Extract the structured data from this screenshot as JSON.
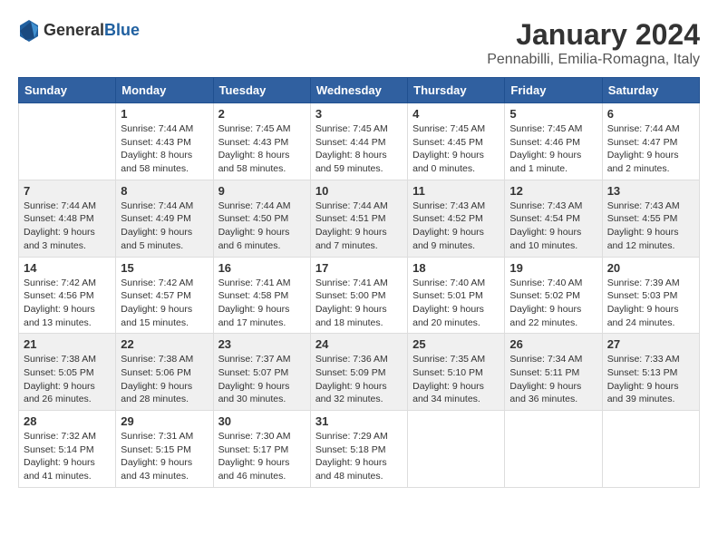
{
  "logo": {
    "general": "General",
    "blue": "Blue"
  },
  "title": "January 2024",
  "location": "Pennabilli, Emilia-Romagna, Italy",
  "weekdays": [
    "Sunday",
    "Monday",
    "Tuesday",
    "Wednesday",
    "Thursday",
    "Friday",
    "Saturday"
  ],
  "weeks": [
    [
      {
        "day": "",
        "info": ""
      },
      {
        "day": "1",
        "info": "Sunrise: 7:44 AM\nSunset: 4:43 PM\nDaylight: 8 hours\nand 58 minutes."
      },
      {
        "day": "2",
        "info": "Sunrise: 7:45 AM\nSunset: 4:43 PM\nDaylight: 8 hours\nand 58 minutes."
      },
      {
        "day": "3",
        "info": "Sunrise: 7:45 AM\nSunset: 4:44 PM\nDaylight: 8 hours\nand 59 minutes."
      },
      {
        "day": "4",
        "info": "Sunrise: 7:45 AM\nSunset: 4:45 PM\nDaylight: 9 hours\nand 0 minutes."
      },
      {
        "day": "5",
        "info": "Sunrise: 7:45 AM\nSunset: 4:46 PM\nDaylight: 9 hours\nand 1 minute."
      },
      {
        "day": "6",
        "info": "Sunrise: 7:44 AM\nSunset: 4:47 PM\nDaylight: 9 hours\nand 2 minutes."
      }
    ],
    [
      {
        "day": "7",
        "info": "Sunrise: 7:44 AM\nSunset: 4:48 PM\nDaylight: 9 hours\nand 3 minutes."
      },
      {
        "day": "8",
        "info": "Sunrise: 7:44 AM\nSunset: 4:49 PM\nDaylight: 9 hours\nand 5 minutes."
      },
      {
        "day": "9",
        "info": "Sunrise: 7:44 AM\nSunset: 4:50 PM\nDaylight: 9 hours\nand 6 minutes."
      },
      {
        "day": "10",
        "info": "Sunrise: 7:44 AM\nSunset: 4:51 PM\nDaylight: 9 hours\nand 7 minutes."
      },
      {
        "day": "11",
        "info": "Sunrise: 7:43 AM\nSunset: 4:52 PM\nDaylight: 9 hours\nand 9 minutes."
      },
      {
        "day": "12",
        "info": "Sunrise: 7:43 AM\nSunset: 4:54 PM\nDaylight: 9 hours\nand 10 minutes."
      },
      {
        "day": "13",
        "info": "Sunrise: 7:43 AM\nSunset: 4:55 PM\nDaylight: 9 hours\nand 12 minutes."
      }
    ],
    [
      {
        "day": "14",
        "info": "Sunrise: 7:42 AM\nSunset: 4:56 PM\nDaylight: 9 hours\nand 13 minutes."
      },
      {
        "day": "15",
        "info": "Sunrise: 7:42 AM\nSunset: 4:57 PM\nDaylight: 9 hours\nand 15 minutes."
      },
      {
        "day": "16",
        "info": "Sunrise: 7:41 AM\nSunset: 4:58 PM\nDaylight: 9 hours\nand 17 minutes."
      },
      {
        "day": "17",
        "info": "Sunrise: 7:41 AM\nSunset: 5:00 PM\nDaylight: 9 hours\nand 18 minutes."
      },
      {
        "day": "18",
        "info": "Sunrise: 7:40 AM\nSunset: 5:01 PM\nDaylight: 9 hours\nand 20 minutes."
      },
      {
        "day": "19",
        "info": "Sunrise: 7:40 AM\nSunset: 5:02 PM\nDaylight: 9 hours\nand 22 minutes."
      },
      {
        "day": "20",
        "info": "Sunrise: 7:39 AM\nSunset: 5:03 PM\nDaylight: 9 hours\nand 24 minutes."
      }
    ],
    [
      {
        "day": "21",
        "info": "Sunrise: 7:38 AM\nSunset: 5:05 PM\nDaylight: 9 hours\nand 26 minutes."
      },
      {
        "day": "22",
        "info": "Sunrise: 7:38 AM\nSunset: 5:06 PM\nDaylight: 9 hours\nand 28 minutes."
      },
      {
        "day": "23",
        "info": "Sunrise: 7:37 AM\nSunset: 5:07 PM\nDaylight: 9 hours\nand 30 minutes."
      },
      {
        "day": "24",
        "info": "Sunrise: 7:36 AM\nSunset: 5:09 PM\nDaylight: 9 hours\nand 32 minutes."
      },
      {
        "day": "25",
        "info": "Sunrise: 7:35 AM\nSunset: 5:10 PM\nDaylight: 9 hours\nand 34 minutes."
      },
      {
        "day": "26",
        "info": "Sunrise: 7:34 AM\nSunset: 5:11 PM\nDaylight: 9 hours\nand 36 minutes."
      },
      {
        "day": "27",
        "info": "Sunrise: 7:33 AM\nSunset: 5:13 PM\nDaylight: 9 hours\nand 39 minutes."
      }
    ],
    [
      {
        "day": "28",
        "info": "Sunrise: 7:32 AM\nSunset: 5:14 PM\nDaylight: 9 hours\nand 41 minutes."
      },
      {
        "day": "29",
        "info": "Sunrise: 7:31 AM\nSunset: 5:15 PM\nDaylight: 9 hours\nand 43 minutes."
      },
      {
        "day": "30",
        "info": "Sunrise: 7:30 AM\nSunset: 5:17 PM\nDaylight: 9 hours\nand 46 minutes."
      },
      {
        "day": "31",
        "info": "Sunrise: 7:29 AM\nSunset: 5:18 PM\nDaylight: 9 hours\nand 48 minutes."
      },
      {
        "day": "",
        "info": ""
      },
      {
        "day": "",
        "info": ""
      },
      {
        "day": "",
        "info": ""
      }
    ]
  ]
}
